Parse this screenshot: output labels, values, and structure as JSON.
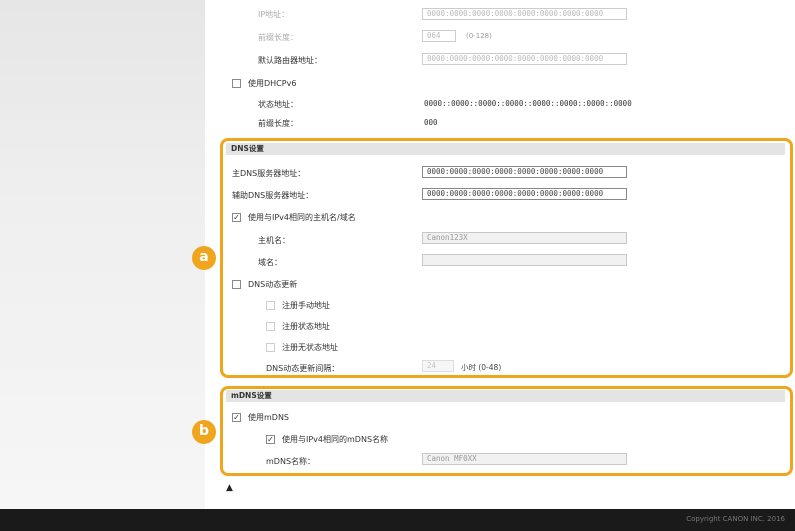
{
  "ipv6_partial": {
    "ip_address_label": "IP地址：",
    "ip_address_value": "0000:0000:0000:0000:0000:0000:0000:0000",
    "prefix_length_label": "前缀长度：",
    "prefix_length_value": "064",
    "prefix_length_hint": "(0-128)",
    "default_router_label": "默认路由器地址：",
    "default_router_value": "0000:0000:0000:0000:0000:0000:0000:0000",
    "use_dhcpv6_label": "使用DHCPv6",
    "state_address_label": "状态地址：",
    "state_address_value": "0000::0000::0000::0000::0000::0000::0000::0000",
    "state_prefix_label": "前缀长度：",
    "state_prefix_value": "000"
  },
  "dns": {
    "header": "DNS设置",
    "primary_dns_label": "主DNS服务器地址：",
    "primary_dns_value": "0000:0000:0000:0000:0000:0000:0000:0000",
    "secondary_dns_label": "辅助DNS服务器地址：",
    "secondary_dns_value": "0000:0000:0000:0000:0000:0000:0000:0000",
    "use_same_host_label": "使用与IPv4相同的主机名/域名",
    "host_name_label": "主机名：",
    "host_name_value": "Canon123X",
    "domain_name_label": "域名：",
    "domain_name_value": "",
    "dynamic_update_label": "DNS动态更新",
    "register_manual_label": "注册手动地址",
    "register_stateful_label": "注册状态地址",
    "register_stateless_label": "注册无状态地址",
    "update_interval_label": "DNS动态更新间隔：",
    "update_interval_value": "24",
    "update_interval_unit": "小时 (0-48)"
  },
  "mdns": {
    "header": "mDNS设置",
    "use_mdns_label": "使用mDNS",
    "use_same_ipv4_label": "使用与IPv4相同的mDNS名称",
    "mdns_name_label": "mDNS名称：",
    "mdns_name_value": "Canon MF0XX"
  },
  "badges": {
    "a": "a",
    "b": "b"
  },
  "checks": {
    "checked": "✓"
  },
  "icons": {
    "top_link": "▲"
  },
  "footer": {
    "copyright": "Copyright CANON INC. 2016"
  },
  "colors": {
    "accent": "#f0a51e",
    "footer_bg": "#1a1a1a"
  }
}
